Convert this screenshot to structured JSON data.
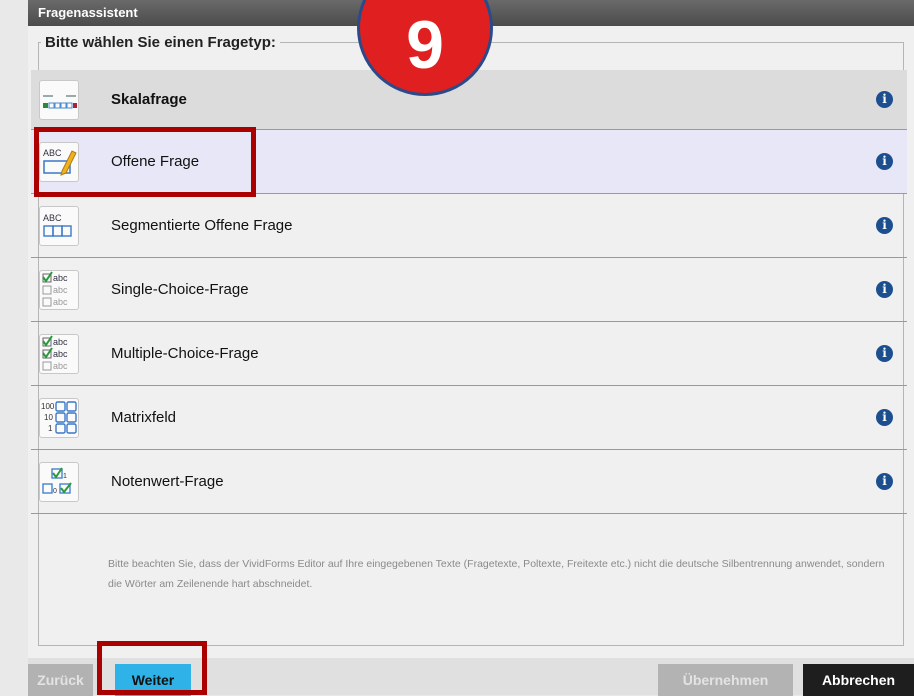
{
  "window": {
    "title": "Fragenassistent"
  },
  "group": {
    "legend": "Bitte wählen Sie einen Fragetyp:"
  },
  "question_types": [
    {
      "label": "Skalafrage",
      "icon": "scale-question-icon"
    },
    {
      "label": "Offene Frage",
      "icon": "open-question-icon"
    },
    {
      "label": "Segmentierte Offene Frage",
      "icon": "segmented-open-question-icon"
    },
    {
      "label": "Single-Choice-Frage",
      "icon": "single-choice-icon"
    },
    {
      "label": "Multiple-Choice-Frage",
      "icon": "multiple-choice-icon"
    },
    {
      "label": "Matrixfeld",
      "icon": "matrix-field-icon"
    },
    {
      "label": "Notenwert-Frage",
      "icon": "grade-value-icon"
    }
  ],
  "icon_text": {
    "abc": "ABC",
    "choice": "abc",
    "matrix_rows": [
      "100",
      "10",
      "1"
    ],
    "grade_small": "1",
    "grade_zero": "0"
  },
  "info_symbol": "i",
  "note": "Bitte beachten Sie, dass der VividForms Editor auf Ihre eingegebenen Texte (Fragetexte, Poltexte, Freitexte etc.) nicht die deutsche Silbentrennung anwendet, sondern die Wörter am Zeilenende hart abschneidet.",
  "buttons": {
    "back": "Zurück",
    "next": "Weiter",
    "apply": "Übernehmen",
    "cancel": "Abbrechen"
  },
  "step_badge": "9",
  "colors": {
    "accent": "#2fb2e7",
    "highlight": "#aa0000",
    "badge": "#e02020",
    "info": "#1d4f8f"
  }
}
